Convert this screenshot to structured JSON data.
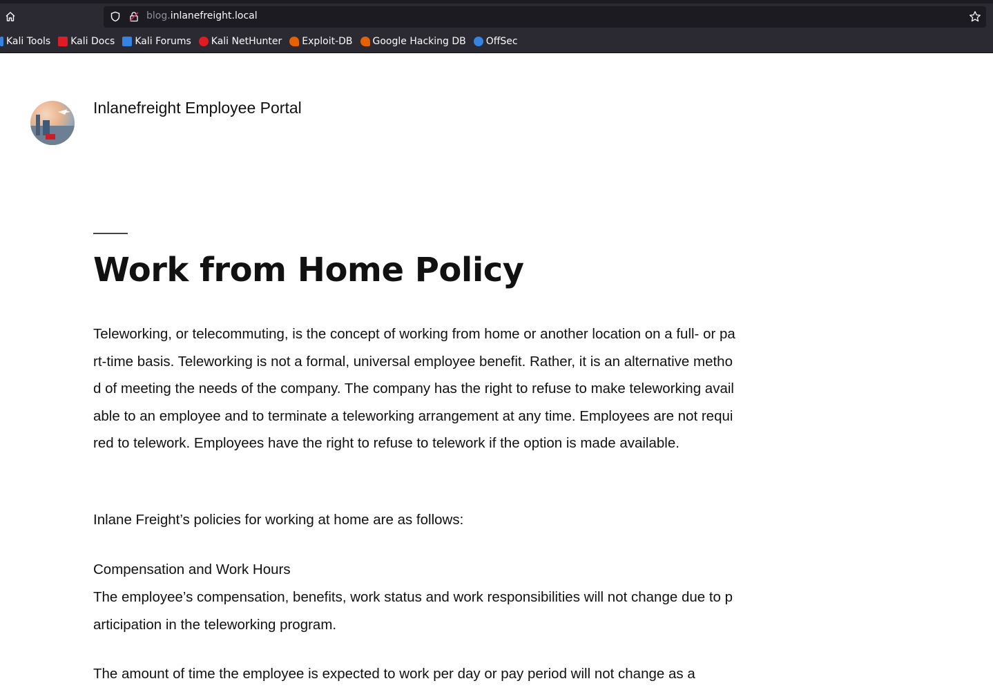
{
  "browser": {
    "url_subdomain": "blog.",
    "url_domain": "inlanefreight.local",
    "bookmarks": [
      {
        "label": "Kali Tools",
        "icon": "kali-dragon-icon",
        "color": "#3584e4"
      },
      {
        "label": "Kali Docs",
        "icon": "kali-docs-icon",
        "color": "#e01b24"
      },
      {
        "label": "Kali Forums",
        "icon": "kali-forums-icon",
        "color": "#3584e4"
      },
      {
        "label": "Kali NetHunter",
        "icon": "kali-nethunter-icon",
        "color": "#e01b24"
      },
      {
        "label": "Exploit-DB",
        "icon": "exploit-db-icon",
        "color": "#e66100"
      },
      {
        "label": "Google Hacking DB",
        "icon": "ghdb-icon",
        "color": "#e66100"
      },
      {
        "label": "OffSec",
        "icon": "offsec-icon",
        "color": "#3584e4"
      }
    ]
  },
  "site": {
    "title": "Inlanefreight Employee Portal"
  },
  "post": {
    "title": "Work from Home Policy",
    "paragraphs": [
      "Teleworking, or telecommuting, is the concept of working from home or another location on a full- or part-time basis. Teleworking is not a formal, universal employee benefit. Rather, it is an alternative method of meeting the needs of the company. The company has the right to refuse to make teleworking available to an employee and to terminate a teleworking arrangement at any time. Employees are not required to telework. Employees have the right to refuse to telework if the option is made available.",
      "Inlane Freight’s policies for working at home are as follows:",
      "The employee’s compensation, benefits, work status and work responsibilities will not change due to participation in the teleworking program.",
      "The amount of time the employee is expected to work per day or pay period will not change as a"
    ],
    "section_heading": "Compensation and Work Hours"
  }
}
